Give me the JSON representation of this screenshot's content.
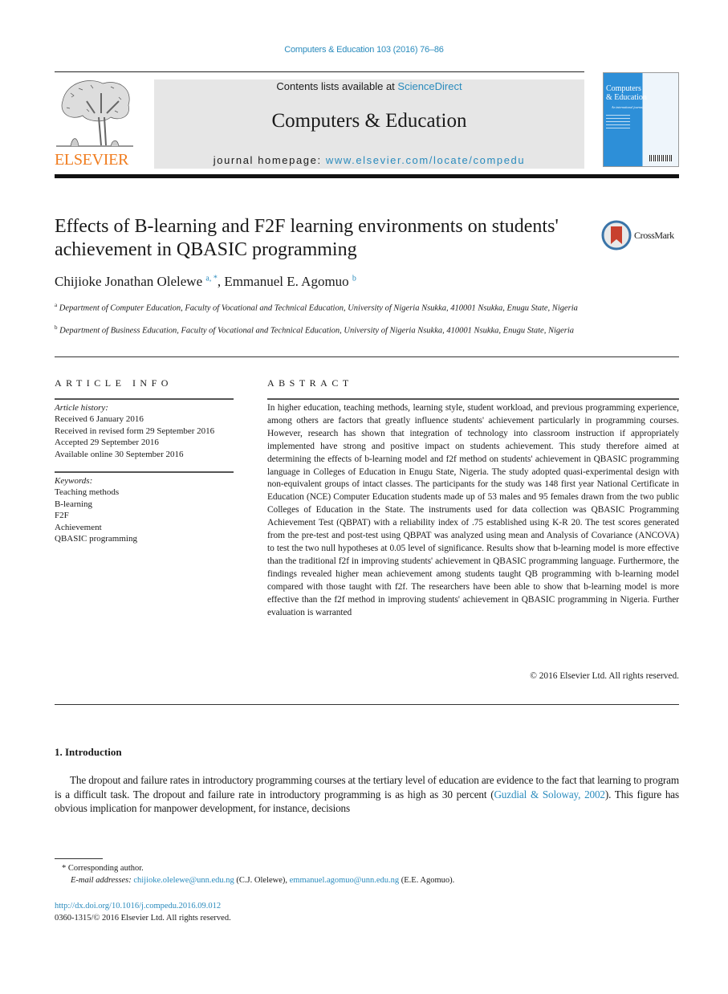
{
  "header": {
    "journal_reference": "Computers & Education 103 (2016) 76–86",
    "contents_prefix": "Contents lists available at ",
    "contents_link": "ScienceDirect",
    "journal_title": "Computers & Education",
    "homepage_prefix": "journal homepage: ",
    "homepage_link": "www.elsevier.com/locate/compedu",
    "publisher_logo_text": "ELSEVIER",
    "cover_title_line1": "Computers",
    "cover_title_line2": "& Education",
    "cover_subtitle": "An international journal"
  },
  "article": {
    "title": "Effects of B-learning and F2F learning environments on students' achievement in QBASIC programming",
    "crossmark_label": "CrossMark",
    "authors": [
      {
        "name": "Chijioke Jonathan Olelewe",
        "sup": "a, *"
      },
      {
        "name": "Emmanuel E. Agomuo",
        "sup": "b"
      }
    ],
    "author_separator": ", ",
    "affiliations": [
      {
        "sup": "a",
        "text": "Department of Computer Education, Faculty of Vocational and Technical Education, University of Nigeria Nsukka, 410001 Nsukka, Enugu State, Nigeria"
      },
      {
        "sup": "b",
        "text": "Department of Business Education, Faculty of Vocational and Technical Education, University of Nigeria Nsukka, 410001 Nsukka, Enugu State, Nigeria"
      }
    ]
  },
  "article_info": {
    "heading": "ARTICLE INFO",
    "history_label": "Article history:",
    "history": [
      "Received 6 January 2016",
      "Received in revised form 29 September 2016",
      "Accepted 29 September 2016",
      "Available online 30 September 2016"
    ],
    "keywords_label": "Keywords:",
    "keywords": [
      "Teaching methods",
      "B-learning",
      "F2F",
      "Achievement",
      "QBASIC programming"
    ]
  },
  "abstract": {
    "heading": "ABSTRACT",
    "text": "In higher education, teaching methods, learning style, student workload, and previous programming experience, among others are factors that greatly influence students' achievement particularly in programming courses. However, research has shown that integration of technology into classroom instruction if appropriately implemented have strong and positive impact on students achievement. This study therefore aimed at determining the effects of b-learning model and f2f method on students' achievement in QBASIC programming language in Colleges of Education in Enugu State, Nigeria. The study adopted quasi-experimental design with non-equivalent groups of intact classes. The participants for the study was 148 first year National Certificate in Education (NCE) Computer Education students made up of 53 males and 95 females drawn from the two public Colleges of Education in the State. The instruments used for data collection was QBASIC Programming Achievement Test (QBPAT) with a reliability index of .75 established using K-R 20. The test scores generated from the pre-test and post-test using QBPAT was analyzed using mean and Analysis of Covariance (ANCOVA) to test the two null hypotheses at 0.05 level of significance. Results show that b-learning model is more effective than the traditional f2f in improving students' achievement in QBASIC programming language. Furthermore, the findings revealed higher mean achievement among students taught QB programming with b-learning model compared with those taught with f2f. The re­searchers have been able to show that b-learning model is more effective than the f2f method in improving students' achievement in QBASIC programming in Nigeria. Further evaluation is warranted",
    "copyright": "© 2016 Elsevier Ltd. All rights reserved."
  },
  "introduction": {
    "heading": "1.  Introduction",
    "para_part1": "The dropout and failure rates in introductory programming courses at the tertiary level of education are evidence to the fact that learning to program is a difficult task. The dropout and failure rate in introductory programming is as high as 30 percent (",
    "citation": "Guzdial & Soloway, 2002",
    "para_part2": "). This figure has obvious implication for manpower development, for instance, decisions"
  },
  "footnotes": {
    "corresponding_marker": "*",
    "corresponding_text": "Corresponding author.",
    "email_label": "E-mail addresses: ",
    "emails": [
      {
        "address": "chijioke.olelewe@unn.edu.ng",
        "owner": " (C.J. Olelewe), "
      },
      {
        "address": "emmanuel.agomuo@unn.edu.ng",
        "owner": " (E.E. Agomuo)."
      }
    ],
    "doi": "http://dx.doi.org/10.1016/j.compedu.2016.09.012",
    "issn_copyright": "0360-1315/© 2016 Elsevier Ltd. All rights reserved."
  },
  "colors": {
    "link": "#2a8bbd",
    "elsevier_orange": "#f07c1e",
    "header_gray": "#e6e6e6",
    "cover_blue": "#2d8fd8"
  }
}
